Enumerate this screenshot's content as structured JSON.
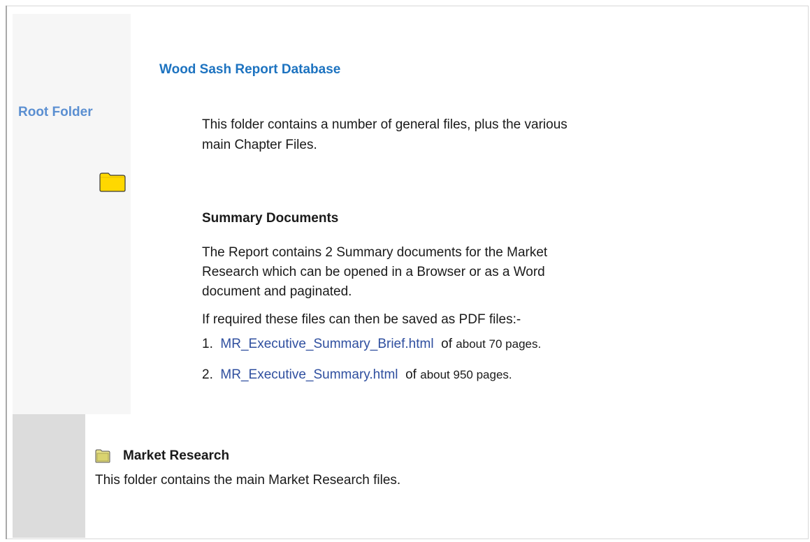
{
  "sidebar": {
    "root_label": "Root Folder"
  },
  "main": {
    "title": "Wood Sash Report Database",
    "intro_line1": "This folder contains a number of general files, plus the various",
    "intro_line2": "main Chapter Files.",
    "summary_heading": "Summary Documents",
    "summary_text": "The Report contains 2 Summary documents for the Market Research which can be opened in a Browser or as a Word document and paginated.",
    "pdf_note": "If required these files can then be saved as PDF files:-",
    "files": [
      {
        "num": "1.",
        "link": "MR_Executive_Summary_Brief.html",
        "of": "of",
        "pages": "about 70 pages."
      },
      {
        "num": "2.",
        "link": "MR_Executive_Summary.html",
        "of": "of",
        "pages": "about 950 pages."
      }
    ]
  },
  "market_research": {
    "title": "Market Research",
    "description": "This folder contains the main Market Research files."
  },
  "icons": [
    "folder-icon",
    "folder-small-icon"
  ],
  "colors": {
    "title_blue": "#1d73c0",
    "root_blue": "#5b8fd1",
    "link_blue": "#2f4f9f",
    "folder_yellow": "#ffd800"
  }
}
